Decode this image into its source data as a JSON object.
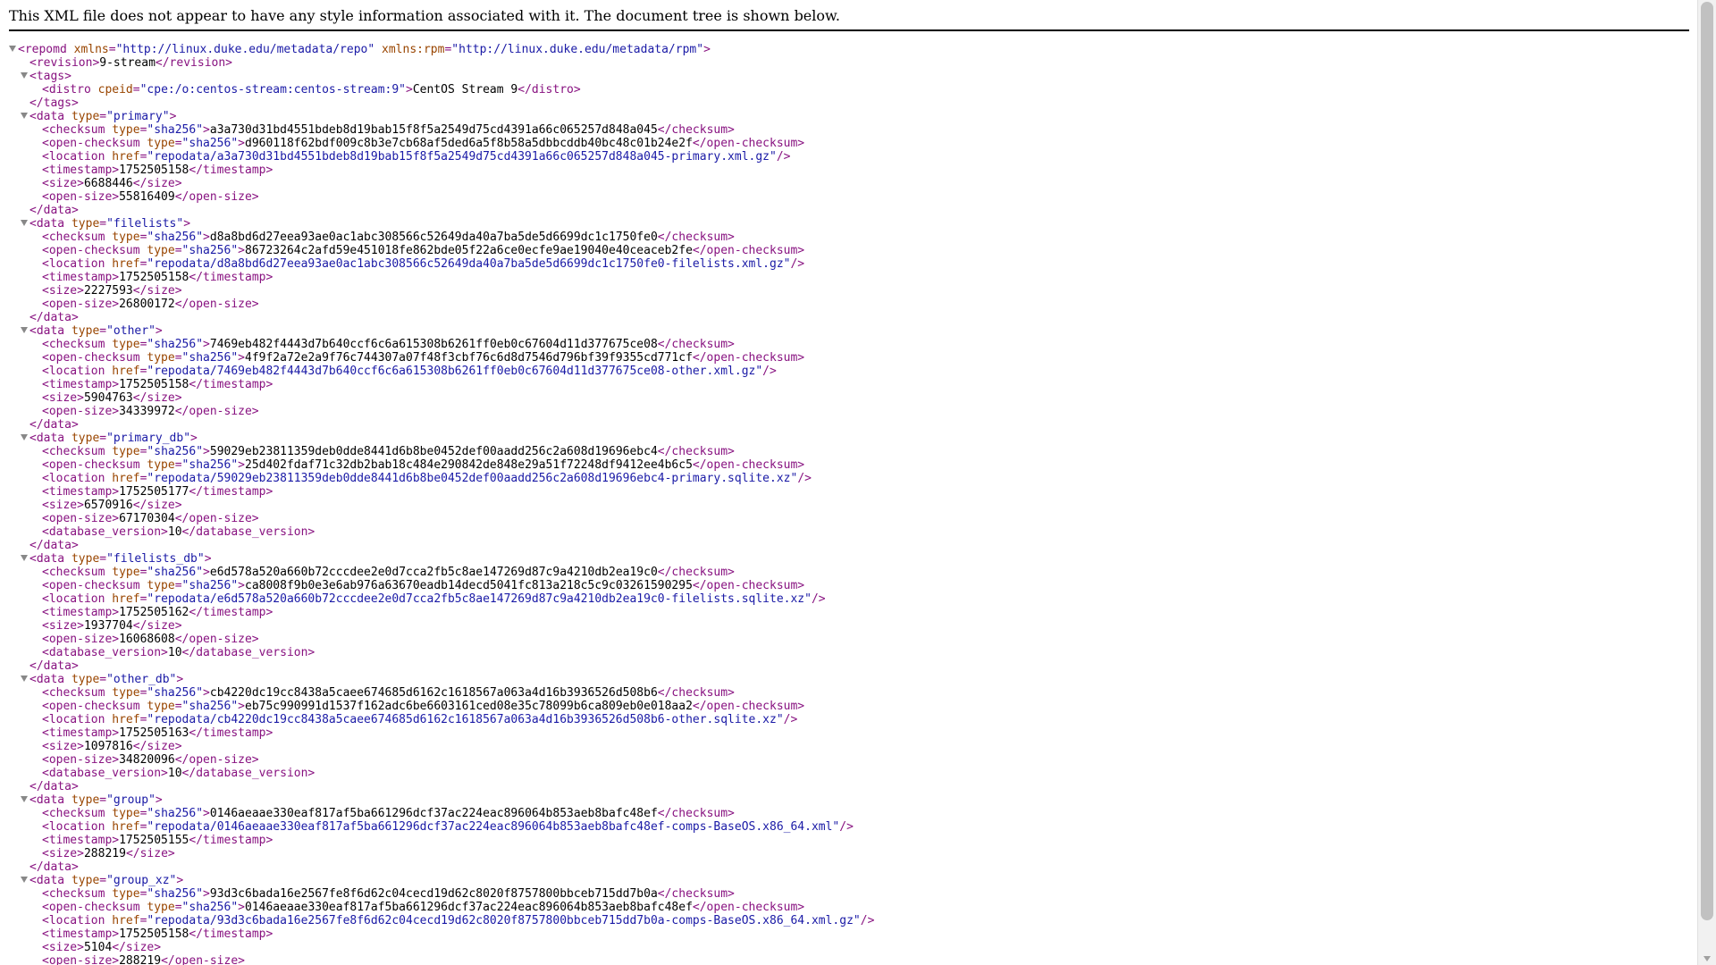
{
  "header": {
    "notice": "This XML file does not appear to have any style information associated with it. The document tree is shown below."
  },
  "root": {
    "open": "<repomd",
    "attr1_name": " xmlns",
    "attr1_value": "\"http://linux.duke.edu/metadata/repo\"",
    "attr2_name": " xmlns:rpm",
    "attr2_value": "\"http://linux.duke.edu/metadata/rpm\"",
    "close": ">"
  },
  "revision": "9-stream",
  "tags": {
    "distro_cpeid": "\"cpe:/o:centos-stream:centos-stream:9\"",
    "distro": "CentOS Stream 9"
  },
  "data": [
    {
      "type": "\"primary\"",
      "checksum": "a3a730d31bd4551bdeb8d19bab15f8f5a2549d75cd4391a66c065257d848a045",
      "open_checksum": "d960118f62bdf009c8b3e7cb68af5ded6a5f8b58a5dbbcddb40bc48c01b24e2f",
      "location": "\"repodata/a3a730d31bd4551bdeb8d19bab15f8f5a2549d75cd4391a66c065257d848a045-primary.xml.gz\"",
      "timestamp": "1752505158",
      "size": "6688446",
      "open_size": "55816409"
    },
    {
      "type": "\"filelists\"",
      "checksum": "d8a8bd6d27eea93ae0ac1abc308566c52649da40a7ba5de5d6699dc1c1750fe0",
      "open_checksum": "86723264c2afd59e451018fe862bde05f22a6ce0ecfe9ae19040e40ceaceb2fe",
      "location": "\"repodata/d8a8bd6d27eea93ae0ac1abc308566c52649da40a7ba5de5d6699dc1c1750fe0-filelists.xml.gz\"",
      "timestamp": "1752505158",
      "size": "2227593",
      "open_size": "26800172"
    },
    {
      "type": "\"other\"",
      "checksum": "7469eb482f4443d7b640ccf6c6a615308b6261ff0eb0c67604d11d377675ce08",
      "open_checksum": "4f9f2a72e2a9f76c744307a07f48f3cbf76c6d8d7546d796bf39f9355cd771cf",
      "location": "\"repodata/7469eb482f4443d7b640ccf6c6a615308b6261ff0eb0c67604d11d377675ce08-other.xml.gz\"",
      "timestamp": "1752505158",
      "size": "5904763",
      "open_size": "34339972"
    },
    {
      "type": "\"primary_db\"",
      "checksum": "59029eb23811359deb0dde8441d6b8be0452def00aadd256c2a608d19696ebc4",
      "open_checksum": "25d402fdaf71c32db2bab18c484e290842de848e29a51f72248df9412ee4b6c5",
      "location": "\"repodata/59029eb23811359deb0dde8441d6b8be0452def00aadd256c2a608d19696ebc4-primary.sqlite.xz\"",
      "timestamp": "1752505177",
      "size": "6570916",
      "open_size": "67170304",
      "database_version": "10"
    },
    {
      "type": "\"filelists_db\"",
      "checksum": "e6d578a520a660b72cccdee2e0d7cca2fb5c8ae147269d87c9a4210db2ea19c0",
      "open_checksum": "ca8008f9b0e3e6ab976a63670eadb14decd5041fc813a218c5c9c03261590295",
      "location": "\"repodata/e6d578a520a660b72cccdee2e0d7cca2fb5c8ae147269d87c9a4210db2ea19c0-filelists.sqlite.xz\"",
      "timestamp": "1752505162",
      "size": "1937704",
      "open_size": "16068608",
      "database_version": "10"
    },
    {
      "type": "\"other_db\"",
      "checksum": "cb4220dc19cc8438a5caee674685d6162c1618567a063a4d16b3936526d508b6",
      "open_checksum": "eb75c990991d1537f162adc6be6603161ced08e35c78099b6ca809eb0e018aa2",
      "location": "\"repodata/cb4220dc19cc8438a5caee674685d6162c1618567a063a4d16b3936526d508b6-other.sqlite.xz\"",
      "timestamp": "1752505163",
      "size": "1097816",
      "open_size": "34820096",
      "database_version": "10"
    },
    {
      "type": "\"group\"",
      "checksum": "0146aeaae330eaf817af5ba661296dcf37ac224eac896064b853aeb8bafc48ef",
      "location": "\"repodata/0146aeaae330eaf817af5ba661296dcf37ac224eac896064b853aeb8bafc48ef-comps-BaseOS.x86_64.xml\"",
      "timestamp": "1752505155",
      "size": "288219"
    },
    {
      "type": "\"group_xz\"",
      "checksum": "93d3c6bada16e2567fe8f6d62c04cecd19d62c8020f8757800bbceb715dd7b0a",
      "open_checksum": "0146aeaae330eaf817af5ba661296dcf37ac224eac896064b853aeb8bafc48ef",
      "location": "\"repodata/93d3c6bada16e2567fe8f6d62c04cecd19d62c8020f8757800bbceb715dd7b0a-comps-BaseOS.x86_64.xml.gz\"",
      "timestamp": "1752505158",
      "size": "5104",
      "open_size": "288219"
    }
  ],
  "tags_text": {
    "revision_open": "<revision>",
    "revision_close": "</revision>",
    "tags_open": "<tags>",
    "tags_close": "</tags>",
    "distro_open": "<distro",
    "distro_attr": " cpeid",
    "distro_close": "</distro>",
    "data_open": "<data",
    "data_close": "</data>",
    "type_attr": " type",
    "checksum_open": "<checksum",
    "checksum_close": "</checksum>",
    "open_checksum_open": "<open-checksum",
    "open_checksum_close": "</open-checksum>",
    "sha_value": "\"sha256\"",
    "location_open": "<location",
    "href_attr": " href",
    "self_close": "/>",
    "timestamp_open": "<timestamp>",
    "timestamp_close": "</timestamp>",
    "size_open": "<size>",
    "size_close": "</size>",
    "open_size_open": "<open-size>",
    "open_size_close": "</open-size>",
    "dbv_open": "<database_version>",
    "dbv_close": "</database_version>",
    "eq": "=",
    "gt": ">"
  }
}
